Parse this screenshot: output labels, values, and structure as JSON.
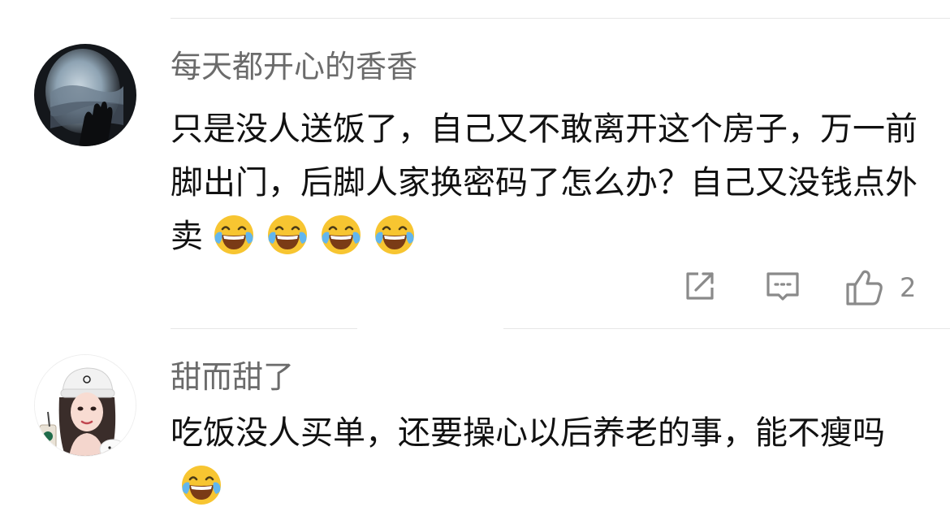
{
  "comments": [
    {
      "username": "每天都开心的香香",
      "avatar": "airplane-window-photo",
      "text": "只是没人送饭了，自己又不敢离开这个房子，万一前脚出门，后脚人家换密码了怎么办？自己又没钱点外卖",
      "emojis": [
        "laughing-tears-emoji",
        "laughing-tears-emoji",
        "laughing-tears-emoji",
        "laughing-tears-emoji"
      ],
      "actions": {
        "share_icon": "share-icon",
        "reply_icon": "comment-reply-icon",
        "like_icon": "thumbs-up-icon",
        "like_count": "2"
      }
    },
    {
      "username": "甜而甜了",
      "avatar": "cartoon-girl-with-hat",
      "text": "吃饭没人买单，还要操心以后养老的事，能不瘦吗",
      "emojis": [
        "laughing-tears-emoji"
      ]
    }
  ],
  "colors": {
    "username": "#6b6b6b",
    "text": "#111111",
    "icon": "#8a8a8a",
    "divider": "#e6e6e6",
    "emoji_face": "#f7c531",
    "emoji_tears": "#62b6ee"
  }
}
